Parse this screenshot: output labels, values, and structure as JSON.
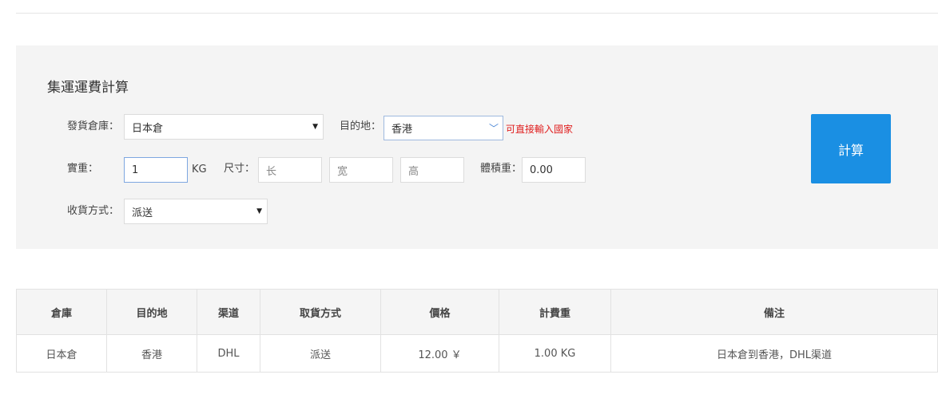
{
  "calculator": {
    "title": "集運運費計算",
    "warehouse": {
      "label": "發貨倉庫：",
      "value": "日本倉"
    },
    "destination": {
      "label": "目的地：",
      "value": "香港",
      "hint": "可直接輸入國家"
    },
    "weight": {
      "label": "實重：",
      "value": "1",
      "unit": "KG"
    },
    "dimensions": {
      "label": "尺寸：",
      "length_placeholder": "长",
      "width_placeholder": "宽",
      "height_placeholder": "高"
    },
    "volume_weight": {
      "label": "體積重：",
      "value": "0.00"
    },
    "delivery": {
      "label": "收貨方式：",
      "value": "派送"
    },
    "submit_label": "計算"
  },
  "result_table": {
    "headers": [
      "倉庫",
      "目的地",
      "渠道",
      "取貨方式",
      "價格",
      "計費重",
      "備注"
    ],
    "rows": [
      [
        "日本倉",
        "香港",
        "DHL",
        "派送",
        "12.00 ￥",
        "1.00 KG",
        "日本倉到香港，DHL渠道"
      ]
    ]
  },
  "colors": {
    "accent": "#1a8fe3",
    "hint": "#e02020",
    "panel": "#f4f4f4"
  }
}
